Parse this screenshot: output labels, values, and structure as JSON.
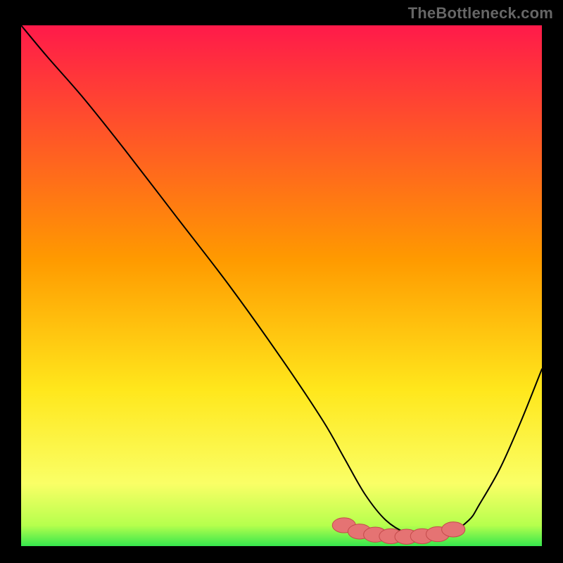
{
  "watermark": "TheBottleneck.com",
  "colors": {
    "background": "#000000",
    "top_gradient": "#ff1a4a",
    "mid_gradient": "#ffe71c",
    "bottom_gradient": "#36e74d",
    "curve": "#000000",
    "marker_fill": "#e57373",
    "marker_stroke": "#c44b4b"
  },
  "chart_data": {
    "type": "line",
    "title": "",
    "xlabel": "",
    "ylabel": "",
    "xlim": [
      0,
      100
    ],
    "ylim": [
      0,
      100
    ],
    "grid": false,
    "legend": null,
    "gradient_stops": [
      {
        "offset": 0,
        "color": "#ff1a4a"
      },
      {
        "offset": 45,
        "color": "#ff9a00"
      },
      {
        "offset": 70,
        "color": "#ffe71c"
      },
      {
        "offset": 88,
        "color": "#faff66"
      },
      {
        "offset": 96,
        "color": "#b6ff4d"
      },
      {
        "offset": 100,
        "color": "#36e74d"
      }
    ],
    "series": [
      {
        "name": "bottleneck-curve",
        "x": [
          0,
          5,
          12,
          20,
          30,
          40,
          50,
          58,
          62,
          66,
          70,
          74,
          78,
          82,
          86,
          88,
          92,
          96,
          100
        ],
        "y": [
          100,
          94,
          86,
          76,
          63,
          50,
          36,
          24,
          17,
          10,
          5,
          2.5,
          1.8,
          2.2,
          5,
          8,
          15,
          24,
          34
        ]
      }
    ],
    "markers": {
      "name": "optimal-range",
      "x": [
        62,
        65,
        68,
        71,
        74,
        77,
        80,
        83
      ],
      "y": [
        4.0,
        2.8,
        2.2,
        1.9,
        1.8,
        1.9,
        2.3,
        3.2
      ],
      "r": 1.6
    }
  }
}
